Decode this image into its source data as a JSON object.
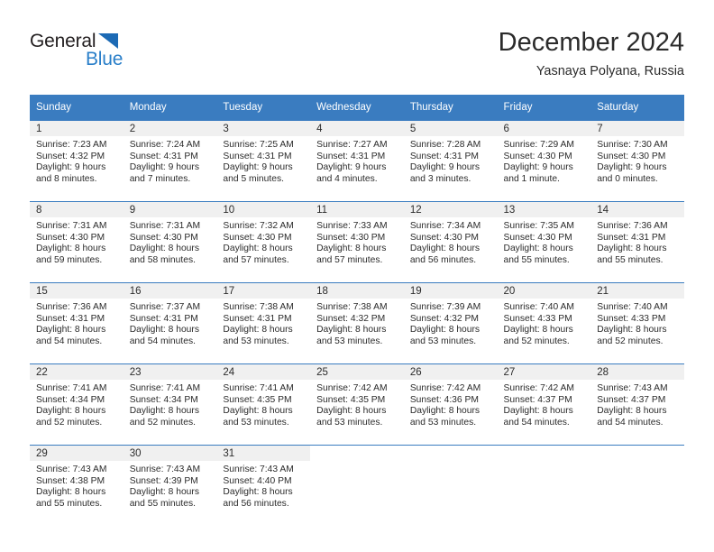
{
  "logo": {
    "word_one": "General",
    "word_two": "Blue",
    "triangle_color": "#1c6ab5",
    "blue_color": "#2a7fc9",
    "dark_color": "#231f20"
  },
  "header": {
    "title": "December 2024",
    "subtitle": "Yasnaya Polyana, Russia"
  },
  "theme": {
    "header_bg": "#3a7cc0",
    "header_text": "#ffffff",
    "daynum_bg": "#f0f0f0",
    "cell_bg": "#ffffff",
    "text": "#2b2b2b"
  },
  "calendar": {
    "weekday_headers": [
      "Sunday",
      "Monday",
      "Tuesday",
      "Wednesday",
      "Thursday",
      "Friday",
      "Saturday"
    ],
    "weeks": [
      [
        {
          "day": "1",
          "sunrise": "Sunrise: 7:23 AM",
          "sunset": "Sunset: 4:32 PM",
          "daylight_line1": "Daylight: 9 hours",
          "daylight_line2": "and 8 minutes."
        },
        {
          "day": "2",
          "sunrise": "Sunrise: 7:24 AM",
          "sunset": "Sunset: 4:31 PM",
          "daylight_line1": "Daylight: 9 hours",
          "daylight_line2": "and 7 minutes."
        },
        {
          "day": "3",
          "sunrise": "Sunrise: 7:25 AM",
          "sunset": "Sunset: 4:31 PM",
          "daylight_line1": "Daylight: 9 hours",
          "daylight_line2": "and 5 minutes."
        },
        {
          "day": "4",
          "sunrise": "Sunrise: 7:27 AM",
          "sunset": "Sunset: 4:31 PM",
          "daylight_line1": "Daylight: 9 hours",
          "daylight_line2": "and 4 minutes."
        },
        {
          "day": "5",
          "sunrise": "Sunrise: 7:28 AM",
          "sunset": "Sunset: 4:31 PM",
          "daylight_line1": "Daylight: 9 hours",
          "daylight_line2": "and 3 minutes."
        },
        {
          "day": "6",
          "sunrise": "Sunrise: 7:29 AM",
          "sunset": "Sunset: 4:30 PM",
          "daylight_line1": "Daylight: 9 hours",
          "daylight_line2": "and 1 minute."
        },
        {
          "day": "7",
          "sunrise": "Sunrise: 7:30 AM",
          "sunset": "Sunset: 4:30 PM",
          "daylight_line1": "Daylight: 9 hours",
          "daylight_line2": "and 0 minutes."
        }
      ],
      [
        {
          "day": "8",
          "sunrise": "Sunrise: 7:31 AM",
          "sunset": "Sunset: 4:30 PM",
          "daylight_line1": "Daylight: 8 hours",
          "daylight_line2": "and 59 minutes."
        },
        {
          "day": "9",
          "sunrise": "Sunrise: 7:31 AM",
          "sunset": "Sunset: 4:30 PM",
          "daylight_line1": "Daylight: 8 hours",
          "daylight_line2": "and 58 minutes."
        },
        {
          "day": "10",
          "sunrise": "Sunrise: 7:32 AM",
          "sunset": "Sunset: 4:30 PM",
          "daylight_line1": "Daylight: 8 hours",
          "daylight_line2": "and 57 minutes."
        },
        {
          "day": "11",
          "sunrise": "Sunrise: 7:33 AM",
          "sunset": "Sunset: 4:30 PM",
          "daylight_line1": "Daylight: 8 hours",
          "daylight_line2": "and 57 minutes."
        },
        {
          "day": "12",
          "sunrise": "Sunrise: 7:34 AM",
          "sunset": "Sunset: 4:30 PM",
          "daylight_line1": "Daylight: 8 hours",
          "daylight_line2": "and 56 minutes."
        },
        {
          "day": "13",
          "sunrise": "Sunrise: 7:35 AM",
          "sunset": "Sunset: 4:30 PM",
          "daylight_line1": "Daylight: 8 hours",
          "daylight_line2": "and 55 minutes."
        },
        {
          "day": "14",
          "sunrise": "Sunrise: 7:36 AM",
          "sunset": "Sunset: 4:31 PM",
          "daylight_line1": "Daylight: 8 hours",
          "daylight_line2": "and 55 minutes."
        }
      ],
      [
        {
          "day": "15",
          "sunrise": "Sunrise: 7:36 AM",
          "sunset": "Sunset: 4:31 PM",
          "daylight_line1": "Daylight: 8 hours",
          "daylight_line2": "and 54 minutes."
        },
        {
          "day": "16",
          "sunrise": "Sunrise: 7:37 AM",
          "sunset": "Sunset: 4:31 PM",
          "daylight_line1": "Daylight: 8 hours",
          "daylight_line2": "and 54 minutes."
        },
        {
          "day": "17",
          "sunrise": "Sunrise: 7:38 AM",
          "sunset": "Sunset: 4:31 PM",
          "daylight_line1": "Daylight: 8 hours",
          "daylight_line2": "and 53 minutes."
        },
        {
          "day": "18",
          "sunrise": "Sunrise: 7:38 AM",
          "sunset": "Sunset: 4:32 PM",
          "daylight_line1": "Daylight: 8 hours",
          "daylight_line2": "and 53 minutes."
        },
        {
          "day": "19",
          "sunrise": "Sunrise: 7:39 AM",
          "sunset": "Sunset: 4:32 PM",
          "daylight_line1": "Daylight: 8 hours",
          "daylight_line2": "and 53 minutes."
        },
        {
          "day": "20",
          "sunrise": "Sunrise: 7:40 AM",
          "sunset": "Sunset: 4:33 PM",
          "daylight_line1": "Daylight: 8 hours",
          "daylight_line2": "and 52 minutes."
        },
        {
          "day": "21",
          "sunrise": "Sunrise: 7:40 AM",
          "sunset": "Sunset: 4:33 PM",
          "daylight_line1": "Daylight: 8 hours",
          "daylight_line2": "and 52 minutes."
        }
      ],
      [
        {
          "day": "22",
          "sunrise": "Sunrise: 7:41 AM",
          "sunset": "Sunset: 4:34 PM",
          "daylight_line1": "Daylight: 8 hours",
          "daylight_line2": "and 52 minutes."
        },
        {
          "day": "23",
          "sunrise": "Sunrise: 7:41 AM",
          "sunset": "Sunset: 4:34 PM",
          "daylight_line1": "Daylight: 8 hours",
          "daylight_line2": "and 52 minutes."
        },
        {
          "day": "24",
          "sunrise": "Sunrise: 7:41 AM",
          "sunset": "Sunset: 4:35 PM",
          "daylight_line1": "Daylight: 8 hours",
          "daylight_line2": "and 53 minutes."
        },
        {
          "day": "25",
          "sunrise": "Sunrise: 7:42 AM",
          "sunset": "Sunset: 4:35 PM",
          "daylight_line1": "Daylight: 8 hours",
          "daylight_line2": "and 53 minutes."
        },
        {
          "day": "26",
          "sunrise": "Sunrise: 7:42 AM",
          "sunset": "Sunset: 4:36 PM",
          "daylight_line1": "Daylight: 8 hours",
          "daylight_line2": "and 53 minutes."
        },
        {
          "day": "27",
          "sunrise": "Sunrise: 7:42 AM",
          "sunset": "Sunset: 4:37 PM",
          "daylight_line1": "Daylight: 8 hours",
          "daylight_line2": "and 54 minutes."
        },
        {
          "day": "28",
          "sunrise": "Sunrise: 7:43 AM",
          "sunset": "Sunset: 4:37 PM",
          "daylight_line1": "Daylight: 8 hours",
          "daylight_line2": "and 54 minutes."
        }
      ],
      [
        {
          "day": "29",
          "sunrise": "Sunrise: 7:43 AM",
          "sunset": "Sunset: 4:38 PM",
          "daylight_line1": "Daylight: 8 hours",
          "daylight_line2": "and 55 minutes."
        },
        {
          "day": "30",
          "sunrise": "Sunrise: 7:43 AM",
          "sunset": "Sunset: 4:39 PM",
          "daylight_line1": "Daylight: 8 hours",
          "daylight_line2": "and 55 minutes."
        },
        {
          "day": "31",
          "sunrise": "Sunrise: 7:43 AM",
          "sunset": "Sunset: 4:40 PM",
          "daylight_line1": "Daylight: 8 hours",
          "daylight_line2": "and 56 minutes."
        },
        {
          "day": "",
          "sunrise": "",
          "sunset": "",
          "daylight_line1": "",
          "daylight_line2": ""
        },
        {
          "day": "",
          "sunrise": "",
          "sunset": "",
          "daylight_line1": "",
          "daylight_line2": ""
        },
        {
          "day": "",
          "sunrise": "",
          "sunset": "",
          "daylight_line1": "",
          "daylight_line2": ""
        },
        {
          "day": "",
          "sunrise": "",
          "sunset": "",
          "daylight_line1": "",
          "daylight_line2": ""
        }
      ]
    ]
  }
}
